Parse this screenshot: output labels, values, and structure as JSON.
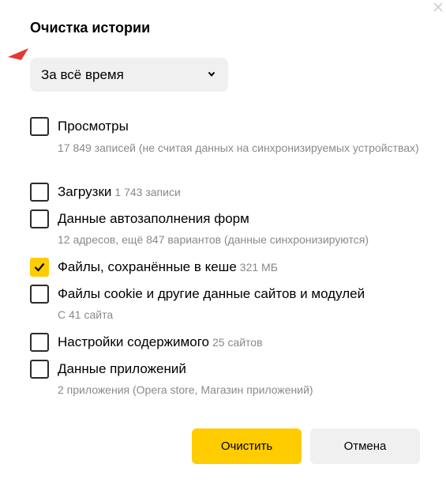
{
  "dialog": {
    "title": "Очистка истории",
    "period_select": {
      "value": "За всё время"
    },
    "items": [
      {
        "label": "Просмотры",
        "count": "",
        "description": "17 849 записей (не считая данных на синхронизируемых устройствах)",
        "checked": false
      },
      {
        "label": "Загрузки",
        "count": "1 743 записи",
        "description": "",
        "checked": false
      },
      {
        "label": "Данные автозаполнения форм",
        "count": "",
        "description": "12 адресов, ещё 847 вариантов (данные синхронизируются)",
        "checked": false
      },
      {
        "label": "Файлы, сохранённые в кеше",
        "count": "321 МБ",
        "description": "",
        "checked": true
      },
      {
        "label": "Файлы cookie и другие данные сайтов и модулей",
        "count": "",
        "description": "С 41 сайта",
        "checked": false
      },
      {
        "label": "Настройки содержимого",
        "count": "25 сайтов",
        "description": "",
        "checked": false
      },
      {
        "label": "Данные приложений",
        "count": "",
        "description": "2 приложения (Opera store, Магазин приложений)",
        "checked": false
      }
    ],
    "buttons": {
      "clear": "Очистить",
      "cancel": "Отмена"
    }
  },
  "colors": {
    "accent": "#ffcc00",
    "arrow": "#e53935",
    "select_bg": "#f0f0f0",
    "muted_text": "#8a8a8a"
  },
  "icons": {
    "close": "close-icon",
    "chevron": "chevron-down-icon",
    "check": "checkmark-icon",
    "pointer": "red-arrow-pointer-icon"
  }
}
